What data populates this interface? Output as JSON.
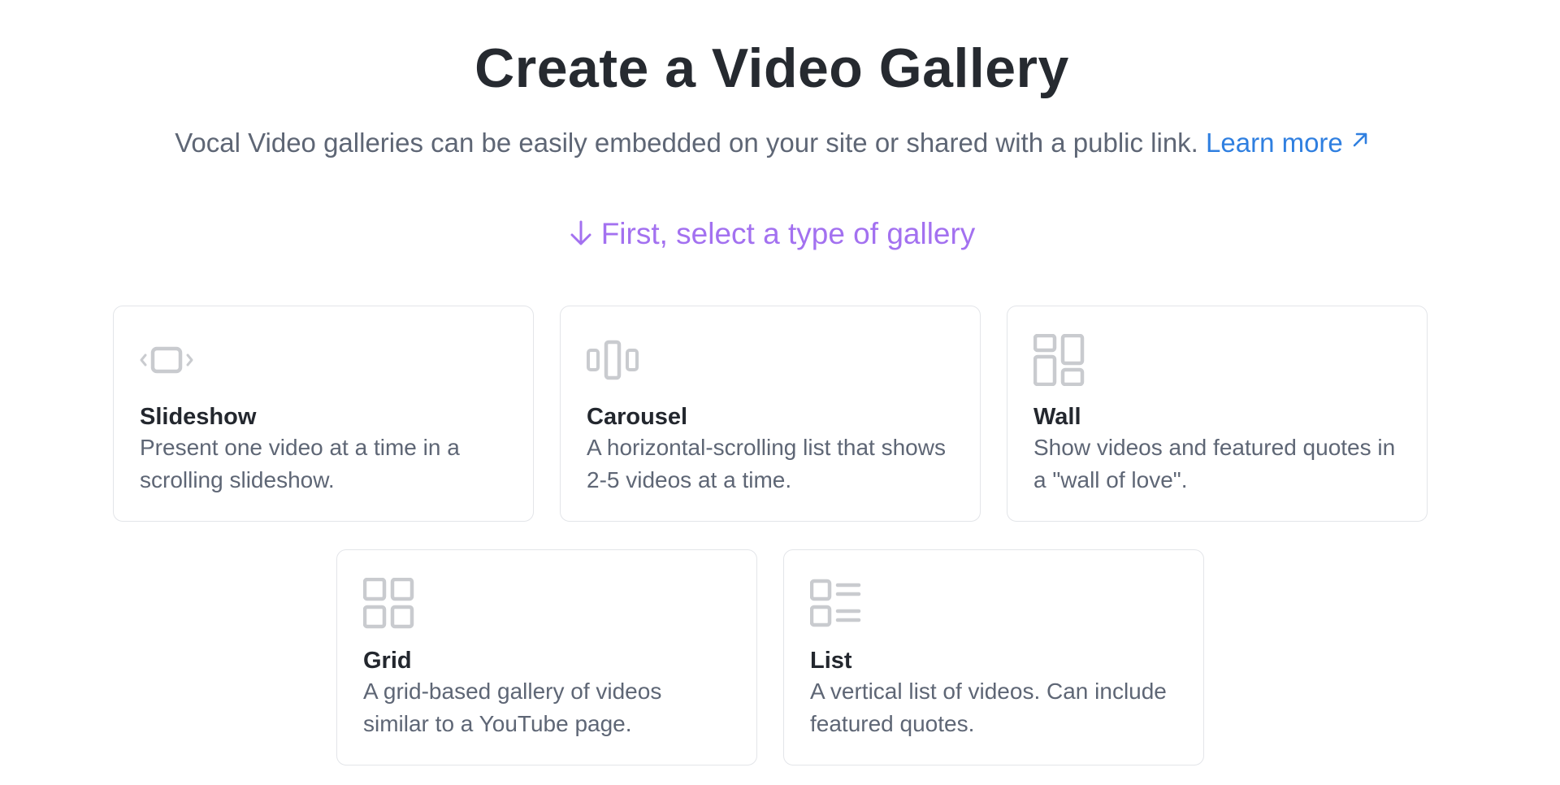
{
  "header": {
    "title": "Create a Video Gallery",
    "subtitle": "Vocal Video galleries can be easily embedded on your site or shared with a public link.",
    "learn_more": "Learn more"
  },
  "prompt": {
    "text": "First, select a type of gallery",
    "color": "#a371f0"
  },
  "gallery_types": [
    {
      "icon": "slideshow-icon",
      "title": "Slideshow",
      "description": "Present one video at a time in a scrolling slideshow."
    },
    {
      "icon": "carousel-icon",
      "title": "Carousel",
      "description": "A horizontal-scrolling list that shows 2-5 videos at a time."
    },
    {
      "icon": "wall-icon",
      "title": "Wall",
      "description": "Show videos and featured quotes in a \"wall of love\"."
    },
    {
      "icon": "grid-icon",
      "title": "Grid",
      "description": "A grid-based gallery of videos similar to a YouTube page."
    },
    {
      "icon": "list-icon",
      "title": "List",
      "description": "A vertical list of videos. Can include featured quotes."
    }
  ],
  "colors": {
    "link": "#2f7fe0",
    "icon_gray": "#c9cbcf",
    "border": "#e3e5e9"
  }
}
